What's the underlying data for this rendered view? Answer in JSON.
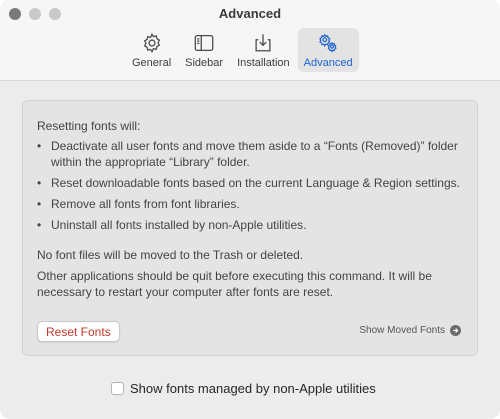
{
  "window": {
    "title": "Advanced"
  },
  "toolbar": {
    "tabs": [
      {
        "label": "General",
        "icon": "gear-icon",
        "active": false
      },
      {
        "label": "Sidebar",
        "icon": "sidebar-icon",
        "active": false
      },
      {
        "label": "Installation",
        "icon": "download-tray-icon",
        "active": false
      },
      {
        "label": "Advanced",
        "icon": "gears-icon",
        "active": true
      }
    ]
  },
  "panel": {
    "intro": "Resetting fonts will:",
    "bullets": [
      "Deactivate all user fonts and move them aside to a “Fonts (Removed)” folder within the appropriate “Library” folder.",
      "Reset downloadable fonts based on the current Language & Region settings.",
      "Remove all fonts from font libraries.",
      "Uninstall all fonts installed by non-Apple utilities."
    ],
    "note_trash": "No font files will be moved to the Trash or deleted.",
    "note_restart": "Other applications should be quit before executing this command. It will be necessary to restart your computer after fonts are reset.",
    "reset_button": "Reset Fonts",
    "moved_link": "Show Moved Fonts"
  },
  "options": {
    "non_apple_label": "Show fonts managed by non-Apple utilities",
    "non_apple_checked": false
  },
  "colors": {
    "accent": "#1e63d0",
    "reset_text": "#c0392b"
  }
}
